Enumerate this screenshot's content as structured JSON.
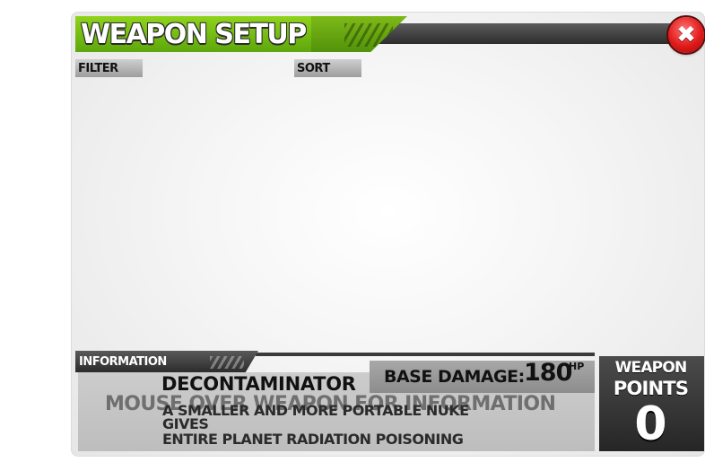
{
  "header": {
    "title": "WEAPON SETUP",
    "close_symbol": "✖",
    "close_icon": "close-icon",
    "accent_color": "#7bc316",
    "close_color": "#e11a1a"
  },
  "controls": {
    "filter_label": "FILTER",
    "sort_label": "SORT"
  },
  "information": {
    "tab_label": "INFORMATION",
    "weapon_name": "DECONTAMINATOR",
    "hint": "MOUSE OVER WEAPON FOR INFORMATION",
    "description_lines": [
      "A SMALLER AND MORE PORTABLE NUKE",
      "GIVES",
      "ENTIRE PLANET RADIATION POISONING"
    ],
    "base_damage_label": "BASE DAMAGE:",
    "base_damage_value": "180",
    "base_damage_unit": "HP"
  },
  "weapon_points": {
    "label_line1": "WEAPON",
    "label_line2": "POINTS",
    "value": "0"
  }
}
